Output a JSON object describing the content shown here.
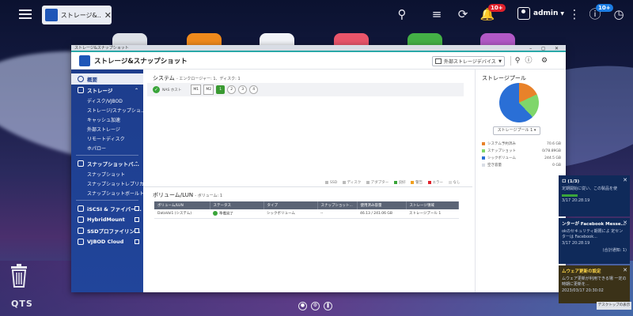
{
  "topbar": {
    "tab_label": "ストレージ&...",
    "tab_close": "✕",
    "notifications_badge": "10+",
    "info_badge": "10+",
    "username": "admin"
  },
  "window": {
    "titlebar": "ストレージ&スナップショット",
    "title": "ストレージ&スナップショット",
    "external_devices_select": "外部ストレージデバイス"
  },
  "sidebar": {
    "overview": "概要",
    "storage": "ストレージ",
    "storage_items": [
      "ディスク/VJBOD",
      "ストレージ/スナップショ...",
      "キャッシュ加速",
      "外部ストレージ",
      "リモートディスク",
      "ホパロー"
    ],
    "snapshot_backup": "スナップショットバ...",
    "snapshot_items": [
      "スナップショット",
      "スナップショットレプリカ",
      "スナップショットボールト"
    ],
    "links": [
      "iSCSI & ファイバー...",
      "HybridMount",
      "SSDプロファイリン...",
      "VJBOD Cloud"
    ]
  },
  "system": {
    "title": "システム",
    "subtitle": "- エンクロージャー: 1、ディスク: 1",
    "nas_label": "NAS ホスト",
    "slots": [
      "M1",
      "M2"
    ],
    "disks": [
      "1",
      "2",
      "3",
      "4"
    ],
    "legend": [
      "SSD",
      "ディスク",
      "アダプター",
      "良好",
      "警告",
      "エラー",
      "なし"
    ]
  },
  "volumes": {
    "title": "ボリューム/LUN",
    "subtitle": "- ボリューム: 1",
    "columns": [
      "ボリューム/LUN",
      "ステータス",
      "タイプ",
      "スナップショット...",
      "使用済み容量",
      "ストレージ領域"
    ],
    "rows": [
      [
        "DataVol1 (システム)",
        "準備完了",
        "シックボリューム",
        "--",
        "46.13 / 241.06 GB",
        "ストレージプール 1"
      ]
    ]
  },
  "pool": {
    "title": "ストレージプール",
    "select": "ストレージプール 1",
    "legend": [
      {
        "label": "システム予約済み",
        "value": "70.6 GB",
        "color": "#e8822a"
      },
      {
        "label": "スナップショット",
        "value": "0/78.89GB",
        "color": "#7fd66a"
      },
      {
        "label": "シックボリューム",
        "value": "244.5 GB",
        "color": "#2a6fd6"
      },
      {
        "label": "空き容量",
        "value": "0 GB",
        "color": "#d9dde5"
      }
    ],
    "pie_fractions": [
      0.18,
      0.2,
      0.62
    ]
  },
  "notifications": [
    {
      "title": "ロ (1/3)",
      "body": "定期開始に従い、この製品を使",
      "time": "3/17 20:28:19"
    },
    {
      "title": "ンターが Facebook Messe...",
      "body": "okのセキュリティ期限によ 定センターは Facebook...",
      "time": "3/17 20:28:19",
      "action": "(合計通知: 1)"
    },
    {
      "title": "ムウェア更新の設定",
      "body": "ムウェア更新が利用できる場 一定の時期に更新を...",
      "time": "2023/03/17 20:30:02"
    }
  ],
  "desktop": {
    "brand": "QTS",
    "show_desktop": "デスクトップの表示"
  }
}
